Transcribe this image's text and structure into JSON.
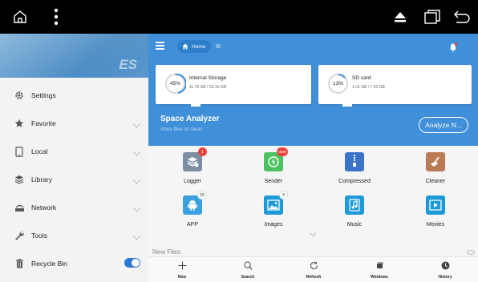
{
  "drawer": {
    "logo_text": "ES",
    "items": [
      {
        "label": "Settings"
      },
      {
        "label": "Favorite"
      },
      {
        "label": "Local"
      },
      {
        "label": "Library"
      },
      {
        "label": "Network"
      },
      {
        "label": "Tools"
      },
      {
        "label": "Recycle Bin"
      }
    ],
    "recycle_bin_enabled": true
  },
  "header": {
    "home_chip_label": "Home"
  },
  "storage": {
    "internal": {
      "percent": "45%",
      "title": "Internal Storage",
      "usage": "11.76 GB / 26.10 GB"
    },
    "sd": {
      "percent": "13%",
      "title": "SD card",
      "usage": "1.01 GB / 7.53 GB"
    }
  },
  "space_analyzer": {
    "title": "Space Analyzer",
    "subtitle": "more files to clean",
    "button_label": "Analyze N..."
  },
  "grid": {
    "items": [
      {
        "label": "Logger",
        "badge": "1"
      },
      {
        "label": "Sender",
        "badge": "NEW"
      },
      {
        "label": "Compressed"
      },
      {
        "label": "Cleaner"
      },
      {
        "label": "APP",
        "badge": "16"
      },
      {
        "label": "Images",
        "badge": "3"
      },
      {
        "label": "Music"
      },
      {
        "label": "Movies"
      }
    ]
  },
  "new_files_label": "New Files",
  "bottom_bar": {
    "items": [
      {
        "label": "New"
      },
      {
        "label": "Search"
      },
      {
        "label": "Refresh"
      },
      {
        "label": "Windows"
      },
      {
        "label": "History"
      }
    ]
  },
  "colors": {
    "accent": "#3f8fd9",
    "badge_red": "#e8413a",
    "logger_bg": "#7d8ea3",
    "sender_bg": "#4cc25e",
    "compressed_bg": "#3b73c9",
    "cleaner_bg": "#b97c57",
    "app_bg": "#3aa1e0",
    "images_bg": "#1e9ad8",
    "music_bg": "#1e9ad8",
    "movies_bg": "#1e9ad8"
  }
}
